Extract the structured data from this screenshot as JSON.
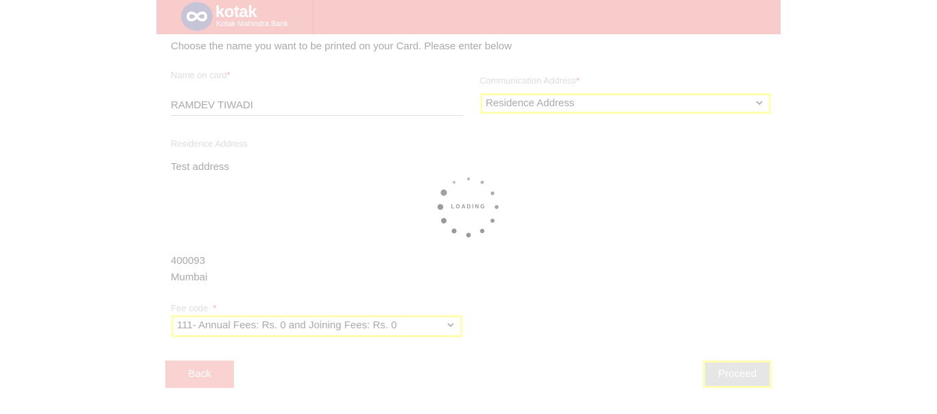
{
  "header": {
    "brand": "kotak",
    "brand_sub": "Kotak Mahindra Bank"
  },
  "form": {
    "instruction": "Choose the name you want to be printed on your Card. Please enter below",
    "name_on_card": {
      "label": "Name on card",
      "required_mark": "*",
      "value": "RAMDEV TIWADI"
    },
    "communication_address": {
      "label": "Communication Address",
      "required_mark": "*",
      "selected": "Residence Address"
    },
    "residence_address": {
      "label": "Residence Address",
      "line1": "Test address",
      "pincode": "400093",
      "city": "Mumbai"
    },
    "fee_code": {
      "label": "Fee code",
      "required_mark": "*",
      "selected": "111- Annual Fees: Rs. 0 and Joining Fees: Rs. 0"
    }
  },
  "buttons": {
    "back": "Back",
    "proceed": "Proceed"
  },
  "loader": {
    "text": "LOADING"
  },
  "colors": {
    "header_bg": "#f9cccc",
    "back_btn": "#fad2d2",
    "focus_outline": "#ffffb0"
  }
}
